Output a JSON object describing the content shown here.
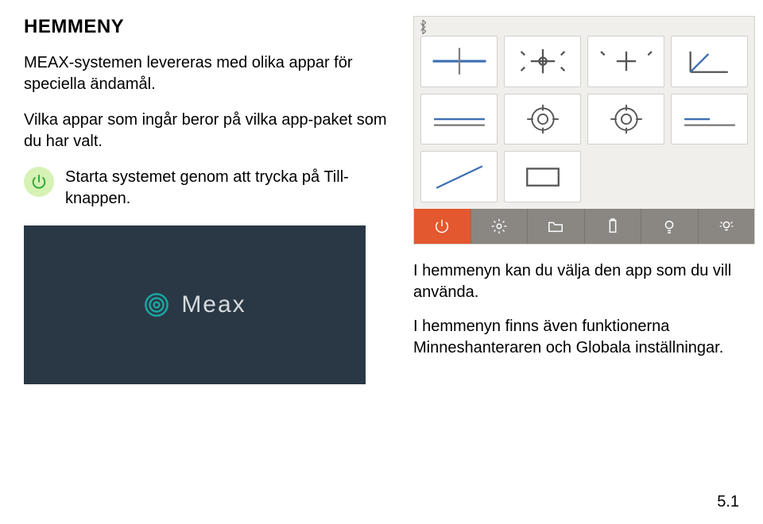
{
  "heading": "HEMMENY",
  "intro_p1": "MEAX-systemen levereras med olika appar för speciella ändamål.",
  "intro_p2": "Vilka appar som ingår beror på vilka app-paket som du har valt.",
  "power_instruction": "Starta systemet genom att trycka på Till-knappen.",
  "splash_brand": "Meax",
  "right_p1": "I hemmenyn kan du välja den app som du vill använda.",
  "right_p2": "I hemmenyn finns även funktionerna Minneshanteraren och Globala inställningar.",
  "page_number": "5.1",
  "icons": {
    "bluetooth": "bluetooth-icon",
    "power": "power-icon",
    "apps": [
      "align-shaft-icon",
      "cross-pump-icon",
      "offset-plus-icon",
      "angle-icon",
      "level-line-icon",
      "target-icon",
      "target-icon",
      "level-short-icon",
      "strike-icon",
      "rect-icon",
      "empty",
      "empty"
    ],
    "toolbar": [
      "power-icon",
      "gear-icon",
      "folder-icon",
      "battery-icon",
      "bulb-icon",
      "bulb-gear-icon"
    ]
  }
}
